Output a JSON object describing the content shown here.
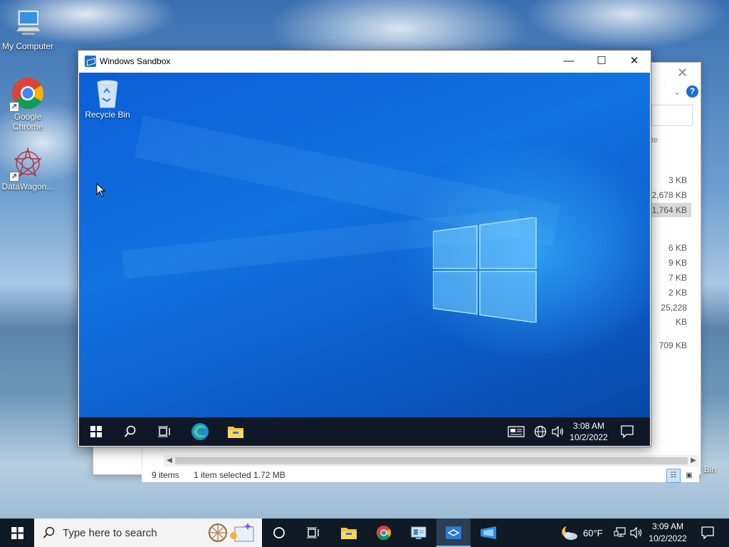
{
  "desktop": {
    "icons": [
      {
        "label": "My Computer"
      },
      {
        "label": "Google Chrome"
      },
      {
        "label": "DataWagon..."
      }
    ],
    "partial_recycle_label": "Bin"
  },
  "explorer": {
    "column_fragment": "te",
    "sizes": [
      "3 KB",
      "2,678 KB",
      "1,764 KB",
      "6 KB",
      "9 KB",
      "7 KB",
      "2 KB",
      "25,228 KB",
      "709 KB"
    ],
    "selected_index": 2,
    "status": {
      "items": "9 items",
      "selected": "1 item selected  1.72 MB"
    }
  },
  "sandbox": {
    "title": "Windows Sandbox",
    "recycle_bin": "Recycle Bin",
    "clock": {
      "time": "3:08 AM",
      "date": "10/2/2022"
    }
  },
  "taskbar": {
    "search_placeholder": "Type here to search",
    "weather": "60°F",
    "clock": {
      "time": "3:09 AM",
      "date": "10/2/2022"
    }
  },
  "colors": {
    "accent": "#1a73e8",
    "taskbar": "#0f1a24",
    "sandbox_desktop": "#0d5cc9"
  }
}
